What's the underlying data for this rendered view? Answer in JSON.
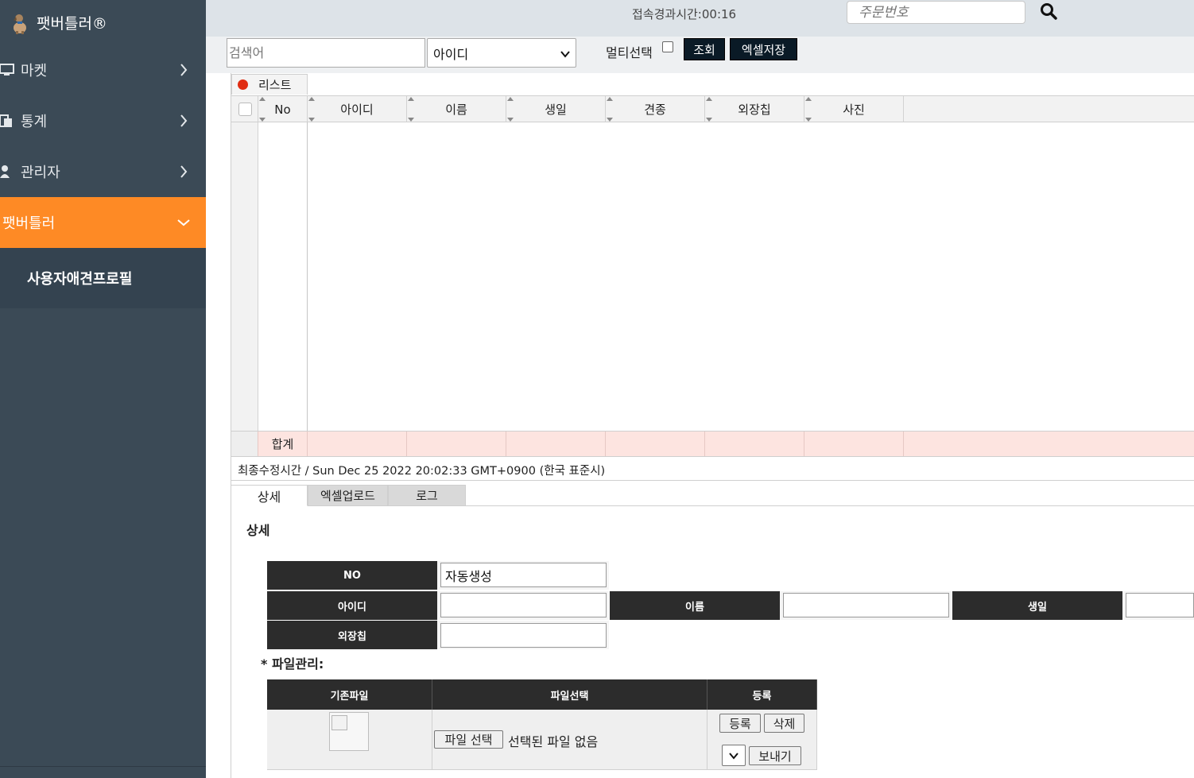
{
  "sidebar": {
    "brand": "팻버틀러®",
    "items": [
      {
        "label": "마켓",
        "icon": "monitor-icon"
      },
      {
        "label": "통계",
        "icon": "copy-icon"
      },
      {
        "label": "관리자",
        "icon": "user-icon"
      },
      {
        "label": "팻버틀러",
        "icon": "",
        "active": true
      }
    ],
    "submenu": [
      "사용자애견프로필"
    ]
  },
  "topbar": {
    "elapsed": "접속경과시간:00:16",
    "order_placeholder": "주문번호"
  },
  "search": {
    "keyword_placeholder": "검색어",
    "field_value": "아이디",
    "multi_label": "멀티선택",
    "query_btn": "조회",
    "excel_btn": "엑셀저장"
  },
  "grid": {
    "tab_label": "리스트",
    "columns": [
      "No",
      "아이디",
      "이름",
      "생일",
      "견종",
      "외장칩",
      "사진"
    ],
    "rows": [],
    "footer_label": "합계",
    "last_modified": "최종수정시간 / Sun Dec 25 2022 20:02:33 GMT+0900 (한국 표준시)"
  },
  "tabs": [
    {
      "label": "상세",
      "active": true
    },
    {
      "label": "엑셀업로드",
      "active": false
    },
    {
      "label": "로그",
      "active": false
    }
  ],
  "detail": {
    "title": "상세",
    "no_label": "NO",
    "no_value": "자동생성",
    "id_label": "아이디",
    "id_value": "",
    "name_label": "이름",
    "name_value": "",
    "birth_label": "생일",
    "birth_value": "",
    "chip_label": "외장칩",
    "chip_value": ""
  },
  "files": {
    "title": "* 파일관리:",
    "headers": [
      "기존파일",
      "파일선택",
      "등록"
    ],
    "choose_btn": "파일 선택",
    "no_file": "선택된 파일 없음",
    "register_btn": "등록",
    "delete_btn": "삭제",
    "send_btn": "보내기"
  },
  "colors": {
    "sidebar_bg": "#3b4a56",
    "accent": "#fe8a25",
    "dark_btn": "#0a1a26",
    "footer_row": "#fde4e0"
  }
}
